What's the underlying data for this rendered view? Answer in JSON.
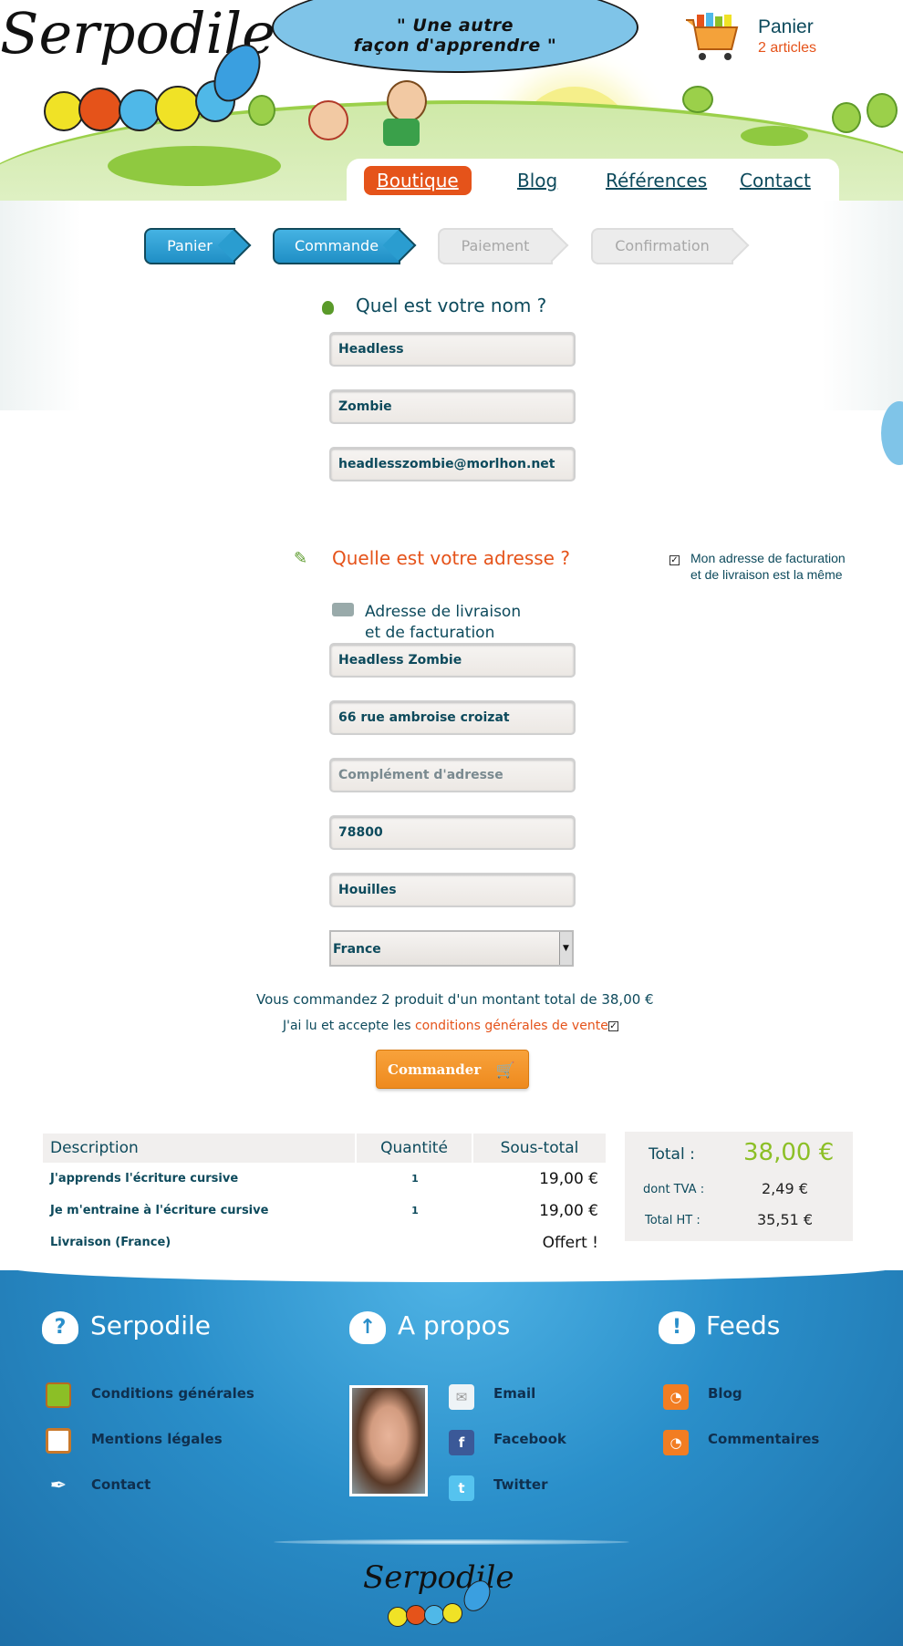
{
  "header": {
    "logo_text": "Serpodile",
    "tagline": "\" Une autre\nfaçon d'apprendre \"",
    "cart_title": "Panier",
    "cart_count": "2 articles"
  },
  "nav": {
    "items": [
      {
        "label": "Boutique"
      },
      {
        "label": "Blog"
      },
      {
        "label": "Références"
      },
      {
        "label": "Contact"
      }
    ]
  },
  "steps": [
    {
      "label": "Panier",
      "state": "active"
    },
    {
      "label": "Commande",
      "state": "active"
    },
    {
      "label": "Paiement",
      "state": "inactive"
    },
    {
      "label": "Confirmation",
      "state": "inactive"
    }
  ],
  "name_section": {
    "title": "Quel est votre nom ?",
    "first_name": "Headless",
    "last_name": "Zombie",
    "email": "headlesszombie@morlhon.net"
  },
  "address_section": {
    "title": "Quelle est votre adresse ?",
    "same_address_label_1": "Mon adresse de facturation",
    "same_address_label_2": "et de livraison est la même",
    "subtitle_1": "Adresse de livraison",
    "subtitle_2": "et de facturation",
    "full_name": "Headless Zombie",
    "street": "66 rue ambroise croizat",
    "complement_placeholder": "Complément d'adresse",
    "postcode": "78800",
    "city": "Houilles",
    "country": "France"
  },
  "summary": {
    "order_text": "Vous commandez 2 produit d'un montant total de 38,00 €",
    "cgv_prefix": "J'ai lu et accepte les ",
    "cgv_link": "conditions générales de vente",
    "order_button": "Commander"
  },
  "order_table": {
    "headers": [
      "Description",
      "Quantité",
      "Sous-total"
    ],
    "rows": [
      {
        "description": "J'apprends l'écriture cursive",
        "quantity": "1",
        "subtotal": "19,00 €"
      },
      {
        "description": "Je m'entraine à l'écriture cursive",
        "quantity": "1",
        "subtotal": "19,00 €"
      },
      {
        "description": "Livraison (France)",
        "quantity": "",
        "subtotal": "Offert !"
      }
    ]
  },
  "totals": {
    "total_label": "Total :",
    "total_value": "38,00 €",
    "tva_label": "dont TVA :",
    "tva_value": "2,49 €",
    "ht_label": "Total HT :",
    "ht_value": "35,51 €"
  },
  "footer": {
    "col1": {
      "title": "Serpodile",
      "links": [
        "Conditions générales",
        "Mentions légales",
        "Contact"
      ]
    },
    "col2": {
      "title": "A propos",
      "links": [
        "Email",
        "Facebook",
        "Twitter"
      ]
    },
    "col3": {
      "title": "Feeds",
      "links": [
        "Blog",
        "Commentaires"
      ]
    },
    "logo_text": "Serpodile"
  },
  "colors": {
    "accent_orange": "#e5531a",
    "text_teal": "#0d4a5c",
    "step_blue": "#2a9dd0",
    "total_green": "#8cbf26",
    "footer_blue": "#2a8fca"
  }
}
